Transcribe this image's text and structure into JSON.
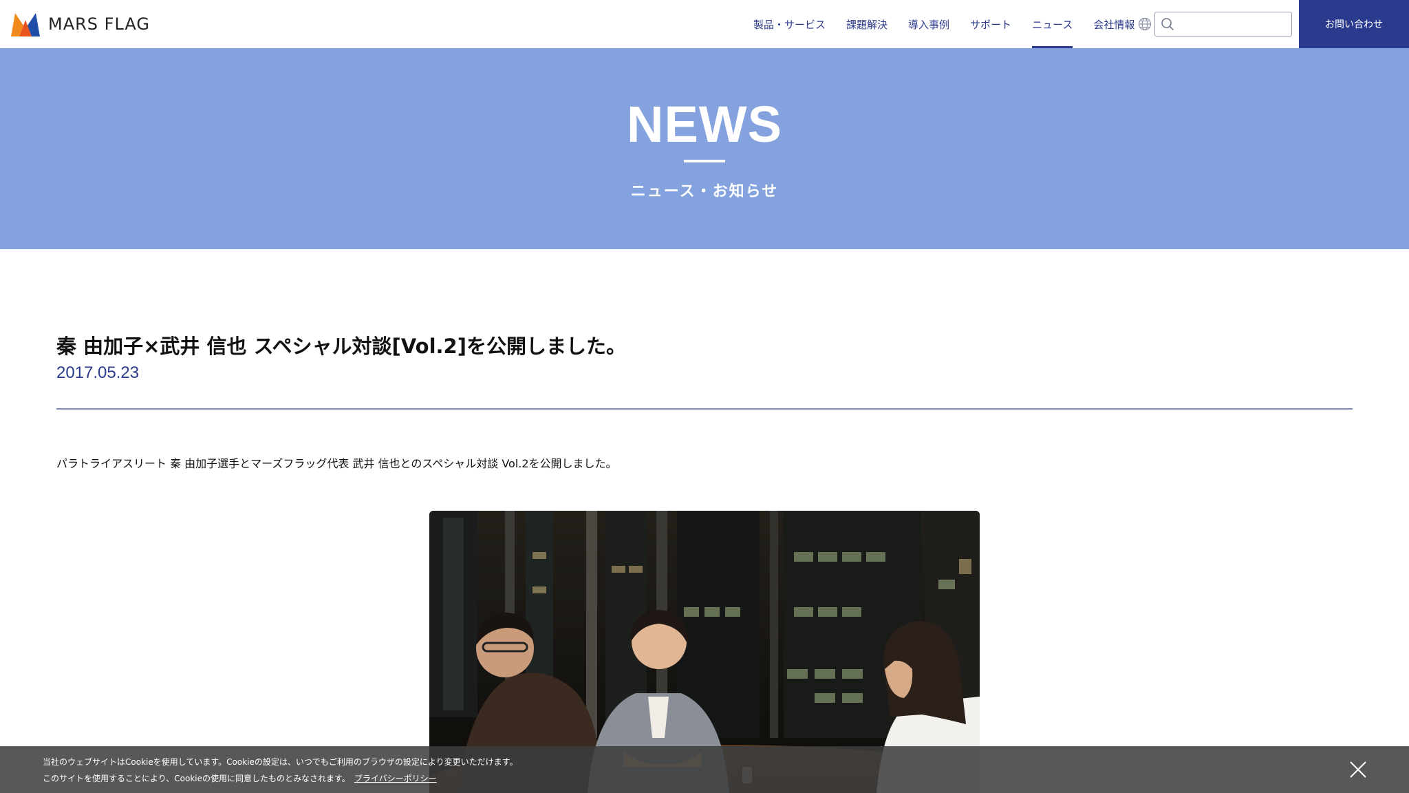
{
  "brand": {
    "name": "MARS FLAG",
    "colors": {
      "navy": "#2a3a8c",
      "hero": "#84a2de",
      "logo_orange": "#f08a1c",
      "logo_blue": "#1f4ea8"
    }
  },
  "nav": {
    "items": [
      {
        "label": "製品・サービス",
        "active": false
      },
      {
        "label": "課題解決",
        "active": false
      },
      {
        "label": "導入事例",
        "active": false
      },
      {
        "label": "サポート",
        "active": false
      },
      {
        "label": "ニュース",
        "active": true
      },
      {
        "label": "会社情報",
        "active": false
      }
    ],
    "language_icon": "globe-icon",
    "search": {
      "placeholder": "",
      "value": "",
      "icon": "search-icon"
    },
    "contact_label": "お問い合わせ"
  },
  "hero": {
    "title": "NEWS",
    "subtitle": "ニュース・お知らせ"
  },
  "article": {
    "title": "秦 由加子×武井 信也 スペシャル対談[Vol.2]を公開しました。",
    "date": "2017.05.23",
    "body": "パラトライアスリート 秦 由加子選手とマーズフラッグ代表 武井 信也とのスペシャル対談 Vol.2を公開しました。"
  },
  "cookie": {
    "line1": "当社のウェブサイトはCookieを使用しています。Cookieの設定は、いつでもご利用のブラウザの設定により変更いただけます。",
    "line2": "このサイトを使用することにより、Cookieの使用に同意したものとみなされます。",
    "link_label": "プライバシーポリシー",
    "close_icon": "close-icon"
  }
}
